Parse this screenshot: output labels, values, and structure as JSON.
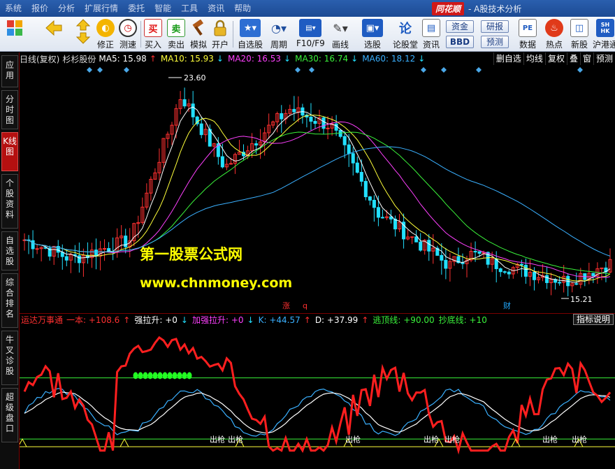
{
  "menu": [
    "系统",
    "报价",
    "分析",
    "扩展行情",
    "委托",
    "智能",
    "工具",
    "资讯",
    "帮助"
  ],
  "brand": {
    "logo": "同花顺",
    "subtitle": "- A股技术分析"
  },
  "toolbar": [
    {
      "label": "",
      "icon": "grid-icon"
    },
    {
      "label": "",
      "icon": "back-arrow-icon"
    },
    {
      "label": "",
      "icon": "up-down-arrow-icon"
    },
    {
      "label": "修正",
      "icon": "adjust-icon"
    },
    {
      "label": "测速",
      "icon": "speed-icon"
    },
    {
      "label": "买入",
      "icon": "buy-icon",
      "glyph": "买"
    },
    {
      "label": "卖出",
      "icon": "sell-icon",
      "glyph": "卖"
    },
    {
      "label": "模拟",
      "icon": "hammer-icon"
    },
    {
      "label": "开户",
      "icon": "lock-icon"
    },
    {
      "label": "自选股",
      "icon": "star-icon"
    },
    {
      "label": "周期",
      "icon": "clock-icon"
    },
    {
      "label": "F10/F9",
      "icon": "f10-icon"
    },
    {
      "label": "画线",
      "icon": "pencil-icon"
    },
    {
      "label": "选股",
      "icon": "select-icon"
    },
    {
      "label": "论股堂",
      "icon": "forum-icon",
      "glyph": "论"
    },
    {
      "label": "资讯",
      "icon": "news-icon"
    },
    {
      "label": "数据",
      "icon": "pe-icon",
      "glyph": "PE"
    },
    {
      "label": "热点",
      "icon": "hot-icon"
    },
    {
      "label": "新股",
      "icon": "ipo-icon"
    },
    {
      "label": "沪港通",
      "icon": "hk-icon",
      "glyph": "SH HK"
    }
  ],
  "pills": {
    "zijin": "资金",
    "yanbao": "研报",
    "bbd": "BBD",
    "yuce": "预测"
  },
  "sidetabs": [
    {
      "label": "应用",
      "active": false
    },
    {
      "label": "分时图",
      "active": false
    },
    {
      "label": "K线图",
      "active": true
    },
    {
      "label": "个股资料",
      "active": false
    },
    {
      "label": "自选股",
      "active": false
    },
    {
      "label": "综合排名",
      "active": false
    },
    {
      "label": "牛叉诊股",
      "active": false
    },
    {
      "label": "超级盘口",
      "active": false
    }
  ],
  "infobar": {
    "period": "日线(复权)",
    "stock": "杉杉股份",
    "ma": [
      {
        "label": "MA5: 15.98",
        "arrow": "↑",
        "color": "#ffffff",
        "arrow_color": "#ff3030"
      },
      {
        "label": "MA10: 15.93",
        "arrow": "↓",
        "color": "#ffff3a",
        "arrow_color": "#22e0ff"
      },
      {
        "label": "MA20: 16.53",
        "arrow": "↓",
        "color": "#ff40ff",
        "arrow_color": "#22e0ff"
      },
      {
        "label": "MA30: 16.74",
        "arrow": "↓",
        "color": "#3af23a",
        "arrow_color": "#22e0ff"
      },
      {
        "label": "MA60: 18.12",
        "arrow": "↓",
        "color": "#3ab0ff",
        "arrow_color": "#22e0ff"
      }
    ],
    "right_buttons": [
      "删自选",
      "均线",
      "复权",
      "叠",
      "窗",
      "预测"
    ]
  },
  "chart_labels": {
    "high": "23.60",
    "low": "15.21",
    "zhang": "涨",
    "q": "q",
    "cai": "财",
    "watermark1": "第一股票公式网",
    "watermark2": "www.chnmoney.com"
  },
  "indicator": {
    "name": "运达万事通",
    "items": [
      {
        "label": "一本: +108.6",
        "arrow": "↑",
        "color": "#ff3030",
        "arrow_color": "#ff3030"
      },
      {
        "label": "强拉升: +0",
        "arrow": "↓",
        "color": "#ffffff",
        "arrow_color": "#22e0ff"
      },
      {
        "label": "加强拉升: +0",
        "arrow": "↓",
        "color": "#ff40ff",
        "arrow_color": "#22e0ff"
      },
      {
        "label": "K: +44.57",
        "arrow": "↑",
        "color": "#3ab0ff",
        "arrow_color": "#ff3030"
      },
      {
        "label": "D: +37.99",
        "arrow": "↑",
        "color": "#ffffff",
        "arrow_color": "#ff3030"
      },
      {
        "label": "逃顶线: +90.00",
        "arrow": "",
        "color": "#3af23a",
        "arrow_color": ""
      },
      {
        "label": "抄底线: +10",
        "arrow": "",
        "color": "#3af23a",
        "arrow_color": ""
      }
    ],
    "help": "指标说明",
    "signal": "出枪"
  },
  "colors": {
    "up": "#ff3030",
    "down": "#22e0ff",
    "ma5": "#ffffff",
    "ma10": "#ffff3a",
    "ma20": "#ff40ff",
    "ma30": "#3af23a",
    "ma60": "#3ab0ff",
    "main_line": "#ff1f1f",
    "threshold": "#3af23a"
  }
}
